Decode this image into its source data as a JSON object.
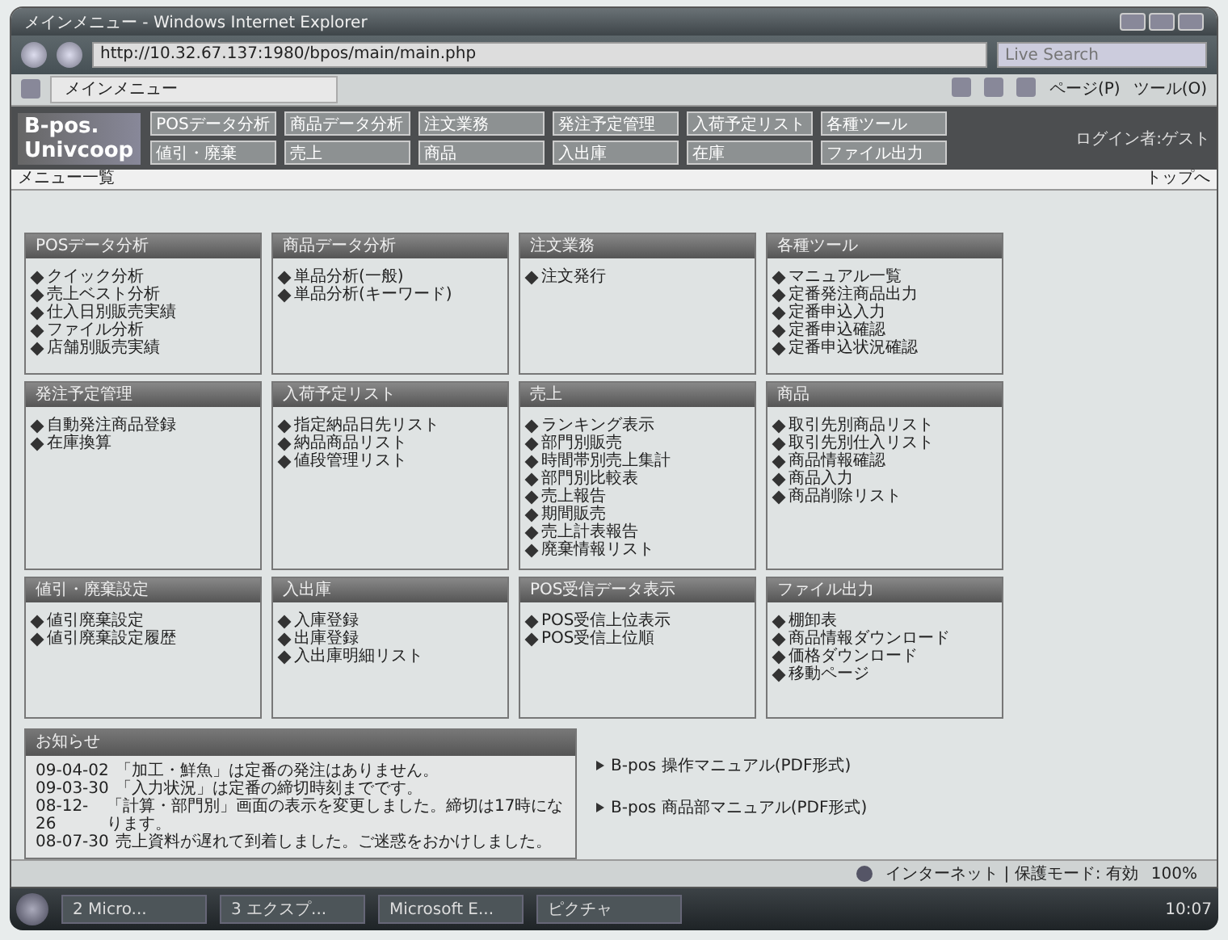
{
  "window": {
    "title": "メインメニュー - Windows Internet Explorer"
  },
  "address_bar": {
    "url": "http://10.32.67.137:1980/bpos/main/main.php",
    "search_placeholder": "Live Search"
  },
  "tab": {
    "label": "メインメニュー"
  },
  "toolbar": {
    "items": [
      "ページ(P)",
      "ツール(O)"
    ]
  },
  "app": {
    "logo_line_1": "B-pos.",
    "logo_line_2": "Univcoop",
    "user": "ログイン者:ゲスト",
    "nav": [
      [
        "POSデータ分析",
        "商品データ分析",
        "注文業務",
        "発注予定管理",
        "入荷予定リスト",
        "各種ツール"
      ],
      [
        "値引・廃棄",
        "売上",
        "商品",
        "入出庫",
        "在庫",
        "ファイル出力"
      ]
    ]
  },
  "breadcrumb": {
    "label": "メニュー一覧",
    "top_link": "トップへ"
  },
  "cards": [
    {
      "title": "POSデータ分析",
      "items": [
        "クイック分析",
        "売上ベスト分析",
        "仕入日別販売実績",
        "ファイル分析",
        "店舗別販売実績"
      ]
    },
    {
      "title": "商品データ分析",
      "items": [
        "単品分析(一般)",
        "単品分析(キーワード)"
      ]
    },
    {
      "title": "注文業務",
      "items": [
        "注文発行"
      ]
    },
    {
      "title": "各種ツール",
      "items": [
        "マニュアル一覧",
        "定番発注商品出力",
        "定番申込入力",
        "定番申込確認",
        "定番申込状況確認"
      ]
    },
    {
      "title": "発注予定管理",
      "items": [
        "自動発注商品登録",
        "在庫換算"
      ]
    },
    {
      "title": "入荷予定リスト",
      "items": [
        "指定納品日先リスト",
        "納品商品リスト",
        "値段管理リスト"
      ]
    },
    {
      "title": "売上",
      "items": [
        "ランキング表示",
        "部門別販売",
        "時間帯別売上集計",
        "部門別比較表",
        "売上報告",
        "期間販売",
        "売上計表報告",
        "廃棄情報リスト"
      ]
    },
    {
      "title": "商品",
      "items": [
        "取引先別商品リスト",
        "取引先別仕入リスト",
        "商品情報確認",
        "商品入力",
        "商品削除リスト"
      ]
    },
    {
      "title": "値引・廃棄設定",
      "items": [
        "値引廃棄設定",
        "値引廃棄設定履歴"
      ]
    },
    {
      "title": "入出庫",
      "items": [
        "入庫登録",
        "出庫登録",
        "入出庫明細リスト"
      ]
    },
    {
      "title": "POS受信データ表示",
      "items": [
        "POS受信上位表示",
        "POS受信上位順"
      ]
    },
    {
      "title": "ファイル出力",
      "items": [
        "棚卸表",
        "商品情報ダウンロード",
        "価格ダウンロード",
        "移動ページ"
      ]
    }
  ],
  "news": {
    "title": "お知らせ",
    "items": [
      {
        "date": "09-04-02",
        "text": "「加工・鮮魚」は定番の発注はありません。"
      },
      {
        "date": "09-03-30",
        "text": "「入力状況」は定番の締切時刻までです。"
      },
      {
        "date": "08-12-26",
        "text": "「計算・部門別」画面の表示を変更しました。締切は17時になります。"
      },
      {
        "date": "08-07-30",
        "text": "売上資料が遅れて到着しました。ご迷惑をおかけしました。"
      }
    ]
  },
  "manual_links": [
    "B-pos 操作マニュアル(PDF形式)",
    "B-pos 商品部マニュアル(PDF形式)"
  ],
  "status_bar": {
    "zone": "インターネット | 保護モード: 有効",
    "zoom": "100%"
  },
  "taskbar": {
    "items": [
      "2 Micro...",
      "3 エクスプ...",
      "Microsoft E...",
      "ピクチャ"
    ],
    "clock": "10:07"
  }
}
